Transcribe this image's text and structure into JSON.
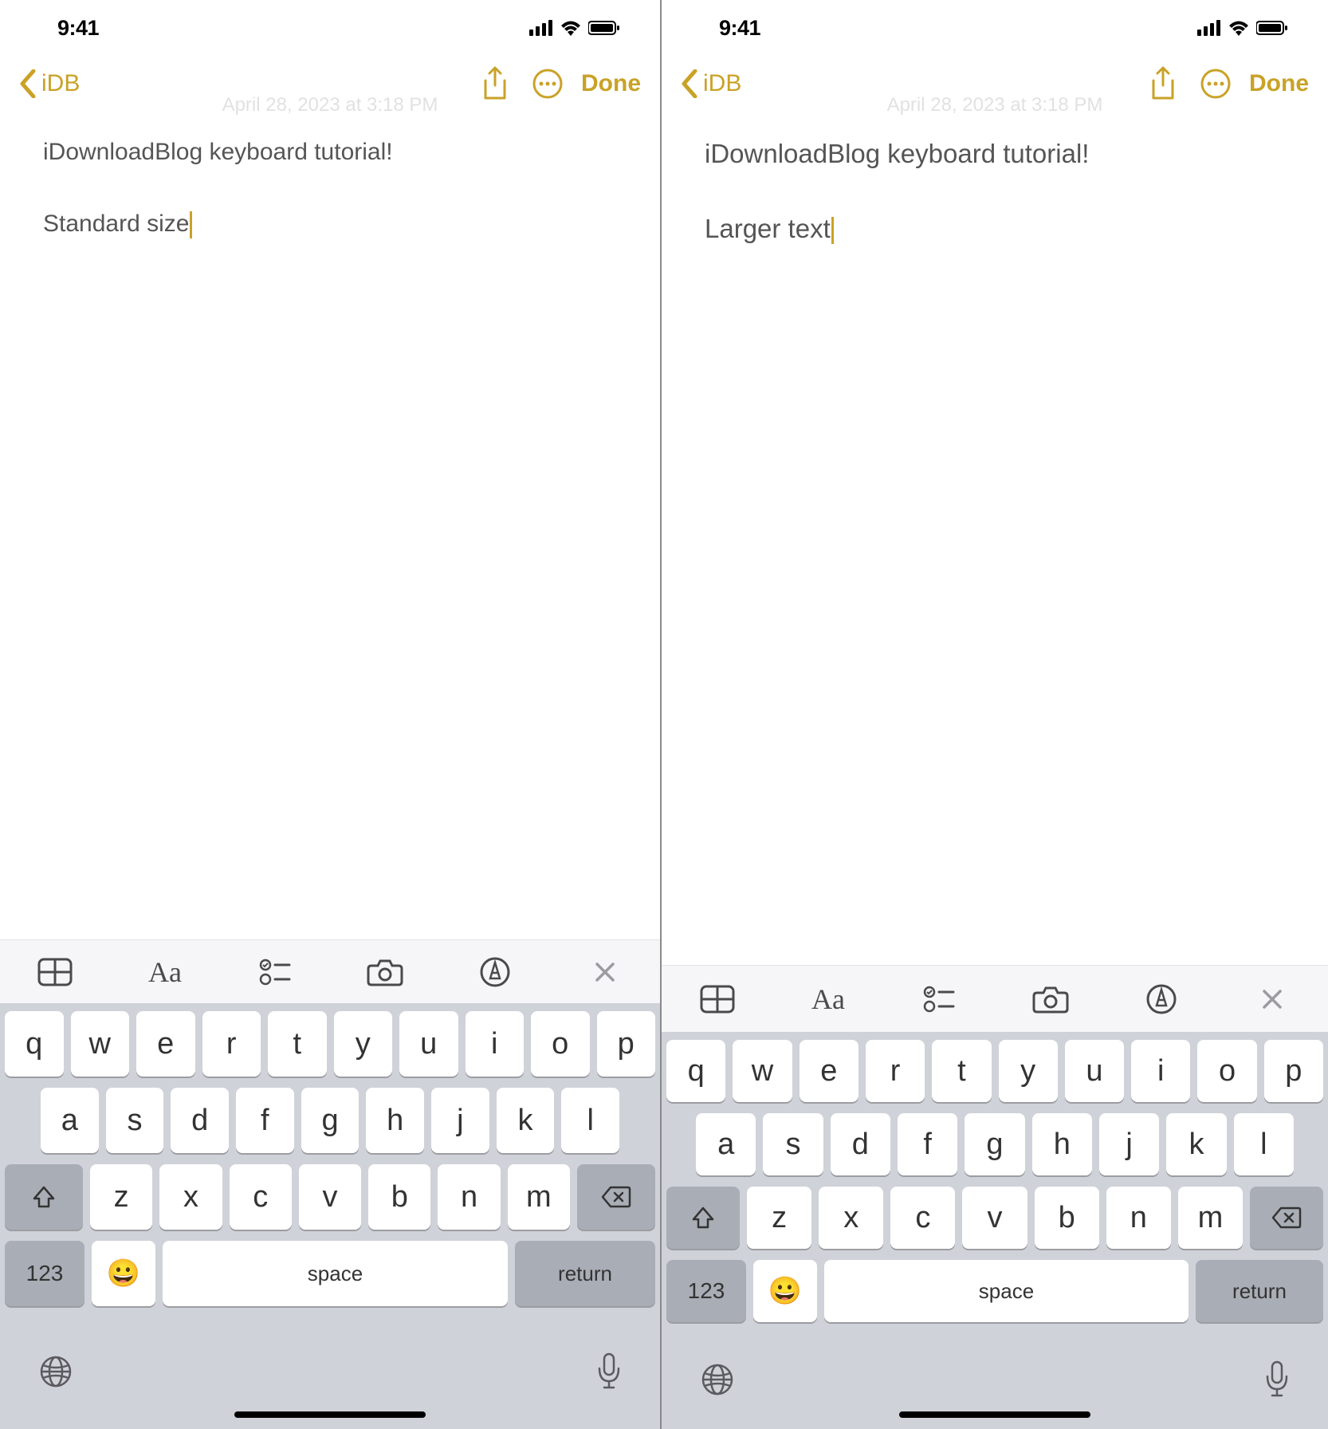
{
  "left": {
    "status_time": "9:41",
    "back_label": "iDB",
    "done_label": "Done",
    "date": "April 28, 2023 at 3:18 PM",
    "title": "iDownloadBlog keyboard tutorial!",
    "body": "Standard size",
    "kb": {
      "row1": [
        "q",
        "w",
        "e",
        "r",
        "t",
        "y",
        "u",
        "i",
        "o",
        "p"
      ],
      "row2": [
        "a",
        "s",
        "d",
        "f",
        "g",
        "h",
        "j",
        "k",
        "l"
      ],
      "row3": [
        "z",
        "x",
        "c",
        "v",
        "b",
        "n",
        "m"
      ],
      "num": "123",
      "space": "space",
      "ret": "return"
    }
  },
  "right": {
    "status_time": "9:41",
    "back_label": "iDB",
    "done_label": "Done",
    "date": "April 28, 2023 at 3:18 PM",
    "title": "iDownloadBlog keyboard tutorial!",
    "body": "Larger text",
    "kb": {
      "row1": [
        "q",
        "w",
        "e",
        "r",
        "t",
        "y",
        "u",
        "i",
        "o",
        "p"
      ],
      "row2": [
        "a",
        "s",
        "d",
        "f",
        "g",
        "h",
        "j",
        "k",
        "l"
      ],
      "row3": [
        "z",
        "x",
        "c",
        "v",
        "b",
        "n",
        "m"
      ],
      "num": "123",
      "space": "space",
      "ret": "return"
    }
  }
}
